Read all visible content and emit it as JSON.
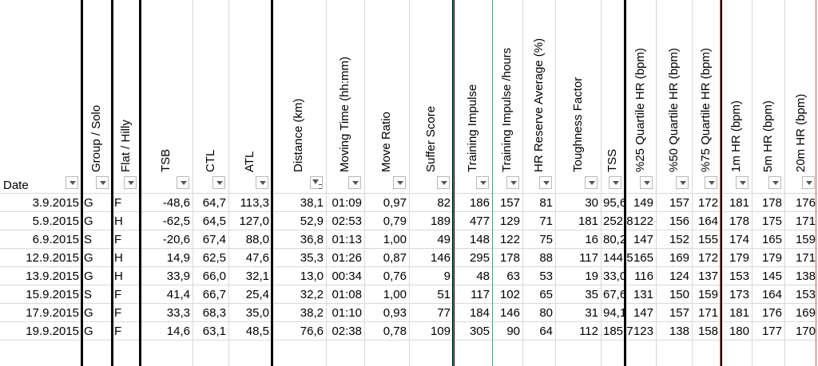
{
  "columns": [
    {
      "key": "date",
      "label": "Date"
    },
    {
      "key": "group",
      "label": "Group / Solo"
    },
    {
      "key": "terrain",
      "label": "Flat / Hilly"
    },
    {
      "key": "tsb",
      "label": "TSB"
    },
    {
      "key": "ctl",
      "label": "CTL"
    },
    {
      "key": "atl",
      "label": "ATL"
    },
    {
      "key": "distance",
      "label": "Distance (km)"
    },
    {
      "key": "moving",
      "label": "Moving Time (hh:mm)"
    },
    {
      "key": "move_ratio",
      "label": "Move Ratio"
    },
    {
      "key": "suffer",
      "label": "Suffer Score"
    },
    {
      "key": "ti",
      "label": "Training Impulse"
    },
    {
      "key": "ti_hours",
      "label": "Training Impulse /hours"
    },
    {
      "key": "hrr",
      "label": "HR Reserve Average (%)"
    },
    {
      "key": "tough",
      "label": "Toughness Factor"
    },
    {
      "key": "tss",
      "label": "TSS"
    },
    {
      "key": "q25",
      "label": "%25 Quartile HR (bpm)"
    },
    {
      "key": "q50",
      "label": "%50 Quartile HR (bpm)"
    },
    {
      "key": "q75",
      "label": "%75 Quartile HR (bpm)"
    },
    {
      "key": "hr1m",
      "label": "1m HR (bpm)"
    },
    {
      "key": "hr5m",
      "label": "5m HR (bpm)"
    },
    {
      "key": "hr20m",
      "label": "20m HR (bpm)"
    }
  ],
  "rows": [
    [
      "3.9.2015",
      "G",
      "F",
      "-48,6",
      "64,7",
      "113,3",
      "38,1",
      "01:09",
      "0,97",
      "82",
      "186",
      "157",
      "81",
      "30",
      "95,6",
      "149",
      "157",
      "172",
      "181",
      "178",
      "176"
    ],
    [
      "5.9.2015",
      "G",
      "H",
      "-62,5",
      "64,5",
      "127,0",
      "52,9",
      "02:53",
      "0,79",
      "189",
      "477",
      "129",
      "71",
      "181",
      "252,8",
      "122",
      "156",
      "164",
      "178",
      "175",
      "171"
    ],
    [
      "6.9.2015",
      "S",
      "F",
      "-20,6",
      "67,4",
      "88,0",
      "36,8",
      "01:13",
      "1,00",
      "49",
      "148",
      "122",
      "75",
      "16",
      "80,2",
      "147",
      "152",
      "155",
      "174",
      "165",
      "159"
    ],
    [
      "12.9.2015",
      "G",
      "H",
      "14,9",
      "62,5",
      "47,6",
      "35,3",
      "01:26",
      "0,87",
      "146",
      "295",
      "178",
      "88",
      "117",
      "144,5",
      "165",
      "169",
      "172",
      "179",
      "179",
      "171"
    ],
    [
      "13.9.2015",
      "G",
      "H",
      "33,9",
      "66,0",
      "32,1",
      "13,0",
      "00:34",
      "0,76",
      "9",
      "48",
      "63",
      "53",
      "19",
      "33,0",
      "116",
      "124",
      "137",
      "153",
      "145",
      "138"
    ],
    [
      "15.9.2015",
      "S",
      "F",
      "41,4",
      "66,7",
      "25,4",
      "32,2",
      "01:08",
      "1,00",
      "51",
      "117",
      "102",
      "65",
      "35",
      "67,6",
      "131",
      "150",
      "159",
      "173",
      "164",
      "153"
    ],
    [
      "17.9.2015",
      "G",
      "F",
      "33,3",
      "68,3",
      "35,0",
      "38,2",
      "01:10",
      "0,93",
      "77",
      "184",
      "146",
      "80",
      "31",
      "94,1",
      "147",
      "157",
      "171",
      "181",
      "176",
      "169"
    ],
    [
      "19.9.2015",
      "G",
      "F",
      "14,6",
      "63,1",
      "48,5",
      "76,6",
      "02:38",
      "0,78",
      "109",
      "305",
      "90",
      "64",
      "112",
      "185,7",
      "123",
      "138",
      "158",
      "180",
      "177",
      "170"
    ]
  ],
  "filter_active_column": "distance"
}
